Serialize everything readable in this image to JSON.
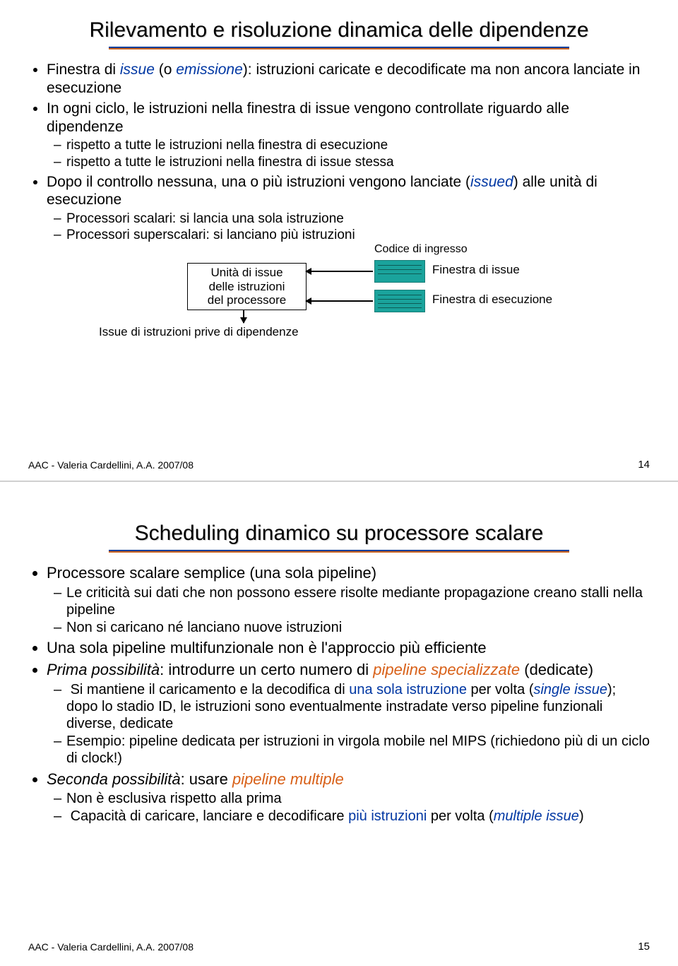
{
  "footer": {
    "credit": "AAC - Valeria Cardellini, A.A. 2007/08"
  },
  "slide1": {
    "title": "Rilevamento e risoluzione dinamica delle dipendenze",
    "b1_a": "Finestra di ",
    "b1_issue": "issue",
    "b1_b": " (o ",
    "b1_emiss": "emissione",
    "b1_c": "): istruzioni caricate e decodificate ma non ancora lanciate in esecuzione",
    "b2": "In ogni ciclo, le istruzioni nella finestra di issue vengono controllate riguardo alle dipendenze",
    "b2s1": "rispetto a tutte le istruzioni nella finestra di esecuzione",
    "b2s2": "rispetto a tutte le istruzioni nella finestra di issue stessa",
    "b3_a": "Dopo il controllo nessuna, una o più istruzioni vengono lanciate (",
    "b3_issued": "issued",
    "b3_b": ") alle unità di esecuzione",
    "b3s1": "Processori scalari: si lancia una sola istruzione",
    "b3s2": "Processori superscalari: si lanciano più istruzioni",
    "diag_top": "Codice di ingresso",
    "diag_box_l1": "Unità di issue",
    "diag_box_l2": "delle istruzioni",
    "diag_box_l3": "del processore",
    "diag_r1": "Finestra di issue",
    "diag_r2": "Finestra di esecuzione",
    "diag_bottom": "Issue di istruzioni prive di dipendenze",
    "page": "14"
  },
  "slide2": {
    "title": "Scheduling dinamico su processore scalare",
    "b1": "Processore scalare semplice (una sola pipeline)",
    "b1s1": "Le criticità sui dati che non possono essere risolte mediante propagazione creano stalli nella pipeline",
    "b1s2": "Non si caricano né lanciano nuove istruzioni",
    "b2": "Una sola pipeline multifunzionale non è l'approccio più efficiente",
    "b3_a": "Prima possibilità",
    "b3_b": ": introdurre un certo numero di ",
    "b3_c": "pipeline specializzate",
    "b3_d": " (dedicate)",
    "b3s1_a": "Si mantiene il caricamento e la decodifica di ",
    "b3s1_b": "una sola istruzione",
    "b3s1_c": " per volta (",
    "b3s1_d": "single issue",
    "b3s1_e": "); dopo lo stadio ID, le istruzioni sono eventualmente instradate verso pipeline funzionali diverse, dedicate",
    "b3s2": "Esempio: pipeline dedicata per istruzioni in virgola mobile nel MIPS (richiedono più di un ciclo di clock!)",
    "b4_a": "Seconda possibilità",
    "b4_b": ": usare ",
    "b4_c": "pipeline multiple",
    "b4s1": "Non è esclusiva rispetto alla prima",
    "b4s2_a": "Capacità di caricare, lanciare e decodificare ",
    "b4s2_b": "più istruzioni",
    "b4s2_c": " per volta (",
    "b4s2_d": "multiple issue",
    "b4s2_e": ")",
    "page": "15"
  }
}
